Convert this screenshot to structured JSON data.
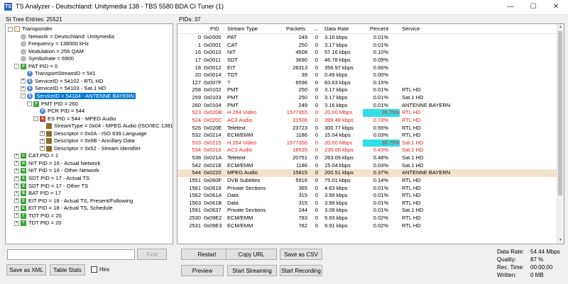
{
  "window": {
    "title": "TS Analyzer - Deutschland: Unitymedia 138 - TBS 5580 BDA CI Tuner (1)",
    "app_icon": "TS"
  },
  "tree": {
    "header": "SI Tree Entries: 25521",
    "items": [
      {
        "text": "Transponder",
        "icon": "doc",
        "level": 0,
        "exp": "-"
      },
      {
        "text": "Network = Deutschland: Unitymedia",
        "icon": "grey",
        "level": 1
      },
      {
        "text": "Frequency = 138000 kHz",
        "icon": "grey",
        "level": 1
      },
      {
        "text": "Modulation = 256 QAM",
        "icon": "grey",
        "level": 1
      },
      {
        "text": "Symbolrate = 6900",
        "icon": "grey",
        "level": 1
      },
      {
        "text": "PAT PID = 0",
        "icon": "green",
        "badge": "P",
        "level": 1,
        "exp": "-"
      },
      {
        "text": "TransportStreamID = 541",
        "icon": "blue",
        "badge": "T",
        "level": 2
      },
      {
        "text": "ServiceID = 54102 - RTL HD",
        "icon": "blue",
        "badge": "S",
        "level": 2,
        "exp": "+"
      },
      {
        "text": "ServiceID = 54103 - Sat.1 HD",
        "icon": "blue",
        "badge": "S",
        "level": 2,
        "exp": "+"
      },
      {
        "text": "ServiceID = 54104 - ANTENNE BAYERN",
        "icon": "blue",
        "badge": "S",
        "level": 2,
        "exp": "-",
        "selected": true
      },
      {
        "text": "PMT PID = 260",
        "icon": "green",
        "badge": "P",
        "level": 3,
        "exp": "-"
      },
      {
        "text": "PCR PID = 544",
        "icon": "blue",
        "badge": "P",
        "level": 4
      },
      {
        "text": "ES PID = 544 - MPEG Audio",
        "icon": "red",
        "badge": "A",
        "level": 4,
        "exp": "-"
      },
      {
        "text": "StreamType = 0x04 - MPEG Audio (ISO/IEC 13818-3)",
        "icon": "olive",
        "level": 5
      },
      {
        "text": "Descriptor = 0x0A - ISO 639 Language",
        "icon": "olive",
        "level": 5,
        "exp": "+"
      },
      {
        "text": "Descriptor = 0x6B - Ancillary Data",
        "icon": "olive",
        "level": 5,
        "exp": "+"
      },
      {
        "text": "Descriptor = 0x52 - Stream Identifier",
        "icon": "olive",
        "level": 5,
        "exp": "+"
      },
      {
        "text": "CAT PID = 1",
        "icon": "green",
        "badge": "C",
        "level": 1,
        "exp": "+"
      },
      {
        "text": "NIT PID = 16 - Actual Network",
        "icon": "green",
        "badge": "N",
        "level": 1,
        "exp": "+"
      },
      {
        "text": "NIT PID = 16 - Other Network",
        "icon": "green",
        "badge": "N",
        "level": 1,
        "exp": "+"
      },
      {
        "text": "SDT PID = 17 - Actual TS",
        "icon": "green",
        "badge": "S",
        "level": 1,
        "exp": "+"
      },
      {
        "text": "SDT PID = 17 - Other TS",
        "icon": "green",
        "badge": "S",
        "level": 1,
        "exp": "+"
      },
      {
        "text": "BAT PID = 17",
        "icon": "green",
        "badge": "B",
        "level": 1,
        "exp": "+"
      },
      {
        "text": "EIT PID = 18 - Actual TS, Present/Following",
        "icon": "green",
        "badge": "E",
        "level": 1,
        "exp": "+"
      },
      {
        "text": "EIT PID = 18 - Actual TS, Schedule",
        "icon": "green",
        "badge": "E",
        "level": 1,
        "exp": "+"
      },
      {
        "text": "TOT PID = 20",
        "icon": "green",
        "badge": "T",
        "level": 1,
        "exp": "+"
      },
      {
        "text": "TDT PID = 20",
        "icon": "green",
        "badge": "T",
        "level": 1,
        "exp": "+"
      }
    ]
  },
  "find": {
    "value": "",
    "button": "Find"
  },
  "left_buttons": {
    "save_xml": "Save as XML",
    "table_stats": "Table Stats",
    "hex_label": "Hex"
  },
  "pids": {
    "header": "PIDs: 37",
    "columns": [
      "PID",
      "Stream Type",
      "Packets",
      "...",
      "Data Rate",
      "Percent",
      "Service"
    ],
    "rows": [
      {
        "pid": "0",
        "hex": "0x0000",
        "type": "PAT",
        "packets": "249",
        "dots": "0",
        "rate": "3.16 kbps",
        "pct": "0.01%",
        "service": ""
      },
      {
        "pid": "1",
        "hex": "0x0001",
        "type": "CAT",
        "packets": "250",
        "dots": "0",
        "rate": "3.17 kbps",
        "pct": "0.01%",
        "service": ""
      },
      {
        "pid": "16",
        "hex": "0x0010",
        "type": "NIT",
        "packets": "4508",
        "dots": "0",
        "rate": "57.16 kbps",
        "pct": "0.10%",
        "service": ""
      },
      {
        "pid": "17",
        "hex": "0x0011",
        "type": "SDT",
        "packets": "3690",
        "dots": "0",
        "rate": "46.78 kbps",
        "pct": "0.09%",
        "service": ""
      },
      {
        "pid": "18",
        "hex": "0x0012",
        "type": "EIT",
        "packets": "28313",
        "dots": "0",
        "rate": "356.97 kbps",
        "pct": "0.66%",
        "service": ""
      },
      {
        "pid": "20",
        "hex": "0x0014",
        "type": "TOT",
        "packets": "39",
        "dots": "0",
        "rate": "0.49 kbps",
        "pct": "0.00%",
        "service": ""
      },
      {
        "pid": "127",
        "hex": "0x007F",
        "type": "?",
        "packets": "6596",
        "dots": "0",
        "rate": "83.63 kbps",
        "pct": "0.15%",
        "service": ""
      },
      {
        "pid": "258",
        "hex": "0x0102",
        "type": "PMT",
        "packets": "250",
        "dots": "0",
        "rate": "3.17 kbps",
        "pct": "0.01%",
        "service": "RTL HD"
      },
      {
        "pid": "259",
        "hex": "0x0103",
        "type": "PMT",
        "packets": "250",
        "dots": "0",
        "rate": "3.17 kbps",
        "pct": "0.01%",
        "service": "Sat.1 HD"
      },
      {
        "pid": "260",
        "hex": "0x0104",
        "type": "PMT",
        "packets": "249",
        "dots": "0",
        "rate": "3.16 kbps",
        "pct": "0.01%",
        "service": "ANTENNE BAYERN"
      },
      {
        "pid": "523",
        "hex": "0x020B",
        "type": "H.264 Video",
        "packets": "1577355",
        "dots": "0",
        "rate": "20.00 Mbps",
        "pct": "36.75%",
        "service": "RTL HD",
        "red": true,
        "pct_hl": true
      },
      {
        "pid": "524",
        "hex": "0x020C",
        "type": "AC3 Audio",
        "packets": "31508",
        "dots": "0",
        "rate": "399.48 kbps",
        "pct": "0.73%",
        "service": "RTL HD",
        "red": true
      },
      {
        "pid": "526",
        "hex": "0x020E",
        "type": "Teletext",
        "packets": "23723",
        "dots": "0",
        "rate": "300.77 kbps",
        "pct": "0.55%",
        "service": "RTL HD"
      },
      {
        "pid": "532",
        "hex": "0x0214",
        "type": "ECM/EMM",
        "packets": "1186",
        "dots": "0",
        "rate": "15.04 kbps",
        "pct": "0.03%",
        "service": "RTL HD"
      },
      {
        "pid": "533",
        "hex": "0x0215",
        "type": "H.264 Video",
        "packets": "1577356",
        "dots": "0",
        "rate": "20.00 Mbps",
        "pct": "36.75%",
        "service": "Sat.1 HD",
        "red": true,
        "pct_hl": true
      },
      {
        "pid": "534",
        "hex": "0x0216",
        "type": "AC3 Audio",
        "packets": "18535",
        "dots": "0",
        "rate": "235.00 kbps",
        "pct": "0.43%",
        "service": "Sat.1 HD",
        "red": true
      },
      {
        "pid": "538",
        "hex": "0x021A",
        "type": "Teletext",
        "packets": "20751",
        "dots": "0",
        "rate": "263.09 kbps",
        "pct": "0.48%",
        "service": "Sat.1 HD"
      },
      {
        "pid": "542",
        "hex": "0x021E",
        "type": "ECM/EMM",
        "packets": "1186",
        "dots": "0",
        "rate": "15.04 kbps",
        "pct": "0.03%",
        "service": "Sat.1 HD"
      },
      {
        "pid": "544",
        "hex": "0x0220",
        "type": "MPEG Audio",
        "packets": "15815",
        "dots": "0",
        "rate": "200.51 kbps",
        "pct": "0.37%",
        "service": "ANTENNE BAYERN",
        "highlight": true
      },
      {
        "pid": "1551",
        "hex": "0x060F",
        "type": "DVB Subtitles",
        "packets": "5916",
        "dots": "0",
        "rate": "75.01 kbps",
        "pct": "0.14%",
        "service": "RTL HD"
      },
      {
        "pid": "1561",
        "hex": "0x0619",
        "type": "Private Sections",
        "packets": "365",
        "dots": "0",
        "rate": "4.63 kbps",
        "pct": "0.01%",
        "service": "RTL HD"
      },
      {
        "pid": "1562",
        "hex": "0x061A",
        "type": "Data",
        "packets": "315",
        "dots": "0",
        "rate": "3.99 kbps",
        "pct": "0.01%",
        "service": "RTL HD"
      },
      {
        "pid": "1563",
        "hex": "0x061B",
        "type": "Data",
        "packets": "315",
        "dots": "0",
        "rate": "3.99 kbps",
        "pct": "0.01%",
        "service": "RTL HD"
      },
      {
        "pid": "1591",
        "hex": "0x0637",
        "type": "Private Sections",
        "packets": "244",
        "dots": "0",
        "rate": "3.09 kbps",
        "pct": "0.01%",
        "service": "Sat.1 HD"
      },
      {
        "pid": "2530",
        "hex": "0x09E2",
        "type": "ECM/EMM",
        "packets": "783",
        "dots": "0",
        "rate": "9.93 kbps",
        "pct": "0.02%",
        "service": "RTL HD"
      },
      {
        "pid": "2531",
        "hex": "0x09E3",
        "type": "ECM/EMM",
        "packets": "782",
        "dots": "0",
        "rate": "9.91 kbps",
        "pct": "0.02%",
        "service": "RTL HD"
      }
    ]
  },
  "buttons": {
    "restart": "Restart",
    "copy_url": "Copy URL",
    "save_csv": "Save as CSV",
    "preview": "Preview",
    "start_streaming": "Start Streaming",
    "start_recording": "Start Recording"
  },
  "stats": {
    "data_rate_label": "Data Rate:",
    "data_rate": "54.44 Mbps",
    "quality_label": "Quality:",
    "quality": "87 %",
    "rec_time_label": "Rec. Time:",
    "rec_time": "00:00:00",
    "written_label": "Written:",
    "written": "0 MB"
  },
  "colors": {
    "selection": "#0078d7",
    "red_text": "#e02020",
    "pct_highlight": "#2fe0e6",
    "row_highlight": "#f4e3cc"
  }
}
